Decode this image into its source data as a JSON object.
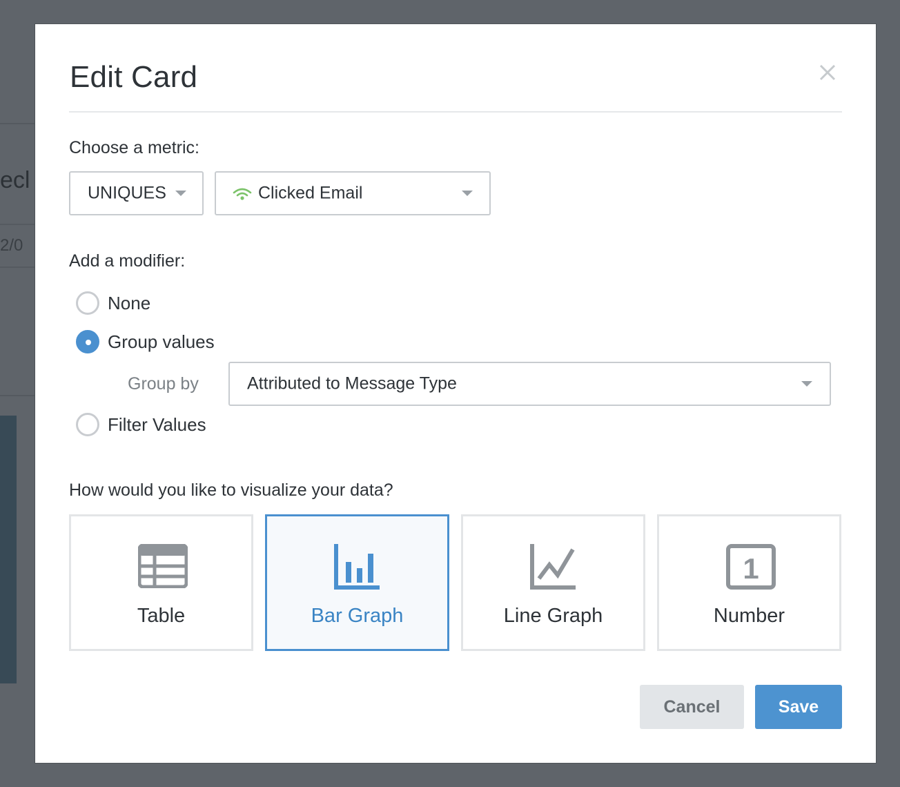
{
  "background": {
    "fragment_1": "ecl",
    "fragment_2": "2/0"
  },
  "modal": {
    "title": "Edit Card",
    "close_icon": "close-icon"
  },
  "metric": {
    "label": "Choose a metric:",
    "aggregation": "UNIQUES",
    "event": "Clicked Email",
    "event_icon": "wifi-signal-icon",
    "event_icon_color": "#7cc36a"
  },
  "modifier": {
    "label": "Add a modifier:",
    "options": [
      {
        "label": "None",
        "checked": false
      },
      {
        "label": "Group values",
        "checked": true
      },
      {
        "label": "Filter Values",
        "checked": false
      }
    ],
    "group_by_label": "Group by",
    "group_by_value": "Attributed to Message Type"
  },
  "visualization": {
    "label": "How would you like to visualize your data?",
    "selected": "Bar Graph",
    "options": [
      {
        "label": "Table",
        "icon": "table-icon"
      },
      {
        "label": "Bar Graph",
        "icon": "bar-graph-icon"
      },
      {
        "label": "Line Graph",
        "icon": "line-graph-icon"
      },
      {
        "label": "Number",
        "icon": "number-icon",
        "icon_glyph": "1"
      }
    ]
  },
  "actions": {
    "cancel": "Cancel",
    "save": "Save"
  },
  "colors": {
    "accent": "#4a90cf",
    "overlay": "#60656b"
  }
}
